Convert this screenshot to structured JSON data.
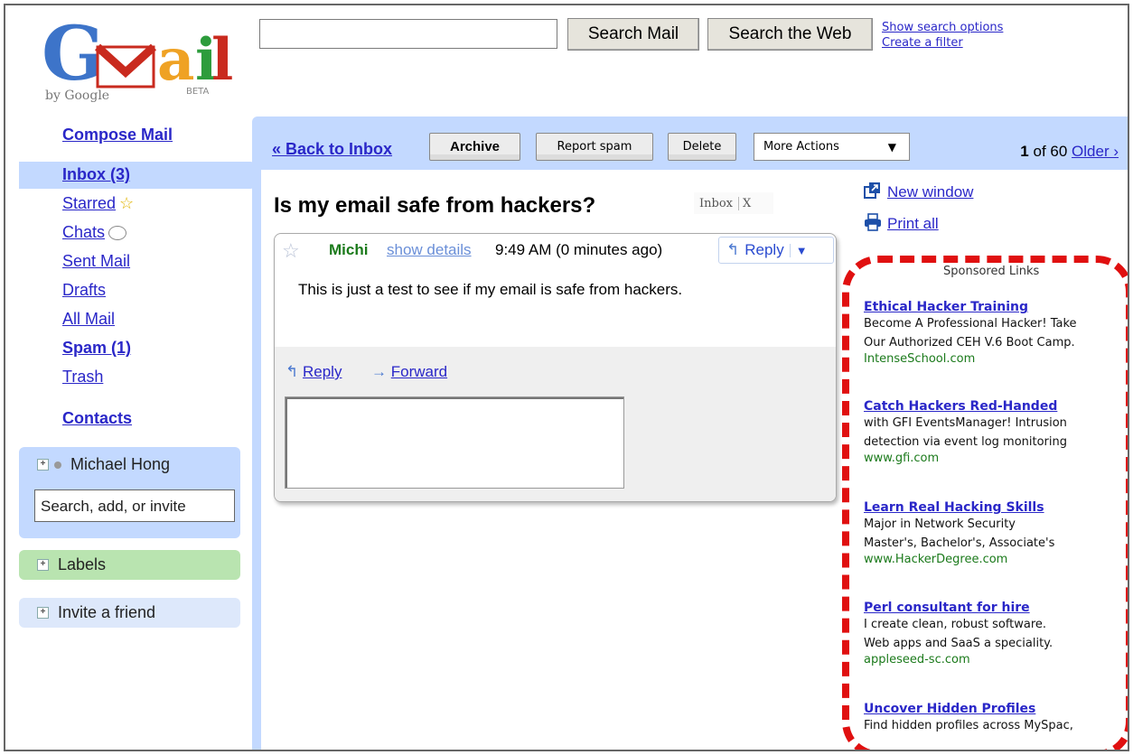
{
  "header": {
    "logo": {
      "brand": "Gmail",
      "tagline": "by Google",
      "badge": "BETA"
    },
    "search_mail": "Search Mail",
    "search_web": "Search the Web",
    "search_options": "Show search options",
    "create_filter": "Create a filter"
  },
  "nav": {
    "compose": "Compose Mail",
    "items": [
      {
        "label": "Inbox (3)",
        "selected": true
      },
      {
        "label": "Starred"
      },
      {
        "label": "Chats"
      },
      {
        "label": "Sent Mail"
      },
      {
        "label": "Drafts"
      },
      {
        "label": "All Mail"
      },
      {
        "label": "Spam (1)"
      },
      {
        "label": "Trash"
      }
    ],
    "contacts": "Contacts",
    "chat": {
      "user": "Michael Hong",
      "search_value": "Search, add, or invite"
    },
    "labels": "Labels",
    "invite": "Invite a friend"
  },
  "toolbar": {
    "back": "« Back to Inbox",
    "archive": "Archive",
    "report_spam": "Report spam",
    "delete": "Delete",
    "more_actions": "More Actions",
    "pager_count": "1",
    "pager_of": "of 60",
    "older": "Older ›"
  },
  "message": {
    "subject": "Is my email safe from hackers?",
    "label": "Inbox",
    "label_remove": "X",
    "sender": "Michi",
    "show_details": "show details",
    "time": "9:49 AM (0 minutes ago)",
    "reply_button": "Reply",
    "body": "This is just a test to see if my email is safe from hackers.",
    "reply": "Reply",
    "forward": "Forward"
  },
  "side": {
    "new_window": "New window",
    "print_all": "Print all"
  },
  "ads": {
    "header": "Sponsored Links",
    "items": [
      {
        "title": "Ethical Hacker Training",
        "lines": [
          "Become A Professional Hacker! Take",
          "Our Authorized CEH V.6 Boot Camp."
        ],
        "url": "IntenseSchool.com"
      },
      {
        "title": "Catch Hackers Red-Handed",
        "lines": [
          "with GFI EventsManager! Intrusion",
          "detection via event log monitoring"
        ],
        "url": "www.gfi.com"
      },
      {
        "title": "Learn Real Hacking Skills",
        "lines": [
          "Major in Network Security",
          "Master's, Bachelor's, Associate's"
        ],
        "url": "www.HackerDegree.com"
      },
      {
        "title": "Perl consultant for hire",
        "lines": [
          "I create clean, robust software.",
          "Web apps and SaaS a speciality."
        ],
        "url": "appleseed-sc.com"
      },
      {
        "title": "Uncover Hidden Profiles",
        "lines": [
          "Find hidden profiles across MySpac,"
        ],
        "url": ""
      }
    ]
  },
  "colors": {
    "highlight": "#e01010",
    "nav_blue": "#c3d9ff",
    "link": "#2a27c8",
    "sender_green": "#1b7a1b"
  }
}
